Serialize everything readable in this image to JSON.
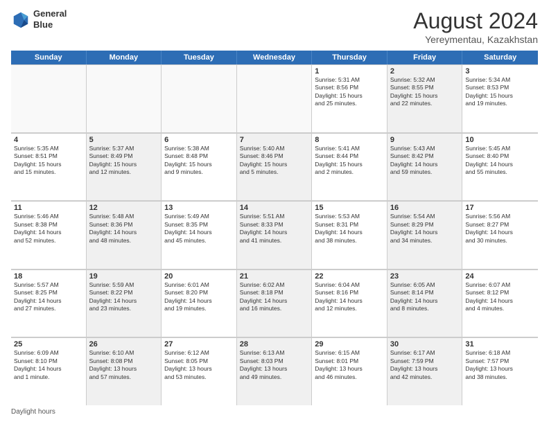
{
  "header": {
    "logo_line1": "General",
    "logo_line2": "Blue",
    "month": "August 2024",
    "location": "Yereymentau, Kazakhstan"
  },
  "weekdays": [
    "Sunday",
    "Monday",
    "Tuesday",
    "Wednesday",
    "Thursday",
    "Friday",
    "Saturday"
  ],
  "footer": "Daylight hours",
  "weeks": [
    [
      {
        "day": "",
        "text": "",
        "empty": true
      },
      {
        "day": "",
        "text": "",
        "empty": true
      },
      {
        "day": "",
        "text": "",
        "empty": true
      },
      {
        "day": "",
        "text": "",
        "empty": true
      },
      {
        "day": "1",
        "text": "Sunrise: 5:31 AM\nSunset: 8:56 PM\nDaylight: 15 hours\nand 25 minutes."
      },
      {
        "day": "2",
        "text": "Sunrise: 5:32 AM\nSunset: 8:55 PM\nDaylight: 15 hours\nand 22 minutes.",
        "shaded": true
      },
      {
        "day": "3",
        "text": "Sunrise: 5:34 AM\nSunset: 8:53 PM\nDaylight: 15 hours\nand 19 minutes."
      }
    ],
    [
      {
        "day": "4",
        "text": "Sunrise: 5:35 AM\nSunset: 8:51 PM\nDaylight: 15 hours\nand 15 minutes."
      },
      {
        "day": "5",
        "text": "Sunrise: 5:37 AM\nSunset: 8:49 PM\nDaylight: 15 hours\nand 12 minutes.",
        "shaded": true
      },
      {
        "day": "6",
        "text": "Sunrise: 5:38 AM\nSunset: 8:48 PM\nDaylight: 15 hours\nand 9 minutes."
      },
      {
        "day": "7",
        "text": "Sunrise: 5:40 AM\nSunset: 8:46 PM\nDaylight: 15 hours\nand 5 minutes.",
        "shaded": true
      },
      {
        "day": "8",
        "text": "Sunrise: 5:41 AM\nSunset: 8:44 PM\nDaylight: 15 hours\nand 2 minutes."
      },
      {
        "day": "9",
        "text": "Sunrise: 5:43 AM\nSunset: 8:42 PM\nDaylight: 14 hours\nand 59 minutes.",
        "shaded": true
      },
      {
        "day": "10",
        "text": "Sunrise: 5:45 AM\nSunset: 8:40 PM\nDaylight: 14 hours\nand 55 minutes."
      }
    ],
    [
      {
        "day": "11",
        "text": "Sunrise: 5:46 AM\nSunset: 8:38 PM\nDaylight: 14 hours\nand 52 minutes."
      },
      {
        "day": "12",
        "text": "Sunrise: 5:48 AM\nSunset: 8:36 PM\nDaylight: 14 hours\nand 48 minutes.",
        "shaded": true
      },
      {
        "day": "13",
        "text": "Sunrise: 5:49 AM\nSunset: 8:35 PM\nDaylight: 14 hours\nand 45 minutes."
      },
      {
        "day": "14",
        "text": "Sunrise: 5:51 AM\nSunset: 8:33 PM\nDaylight: 14 hours\nand 41 minutes.",
        "shaded": true
      },
      {
        "day": "15",
        "text": "Sunrise: 5:53 AM\nSunset: 8:31 PM\nDaylight: 14 hours\nand 38 minutes."
      },
      {
        "day": "16",
        "text": "Sunrise: 5:54 AM\nSunset: 8:29 PM\nDaylight: 14 hours\nand 34 minutes.",
        "shaded": true
      },
      {
        "day": "17",
        "text": "Sunrise: 5:56 AM\nSunset: 8:27 PM\nDaylight: 14 hours\nand 30 minutes."
      }
    ],
    [
      {
        "day": "18",
        "text": "Sunrise: 5:57 AM\nSunset: 8:25 PM\nDaylight: 14 hours\nand 27 minutes."
      },
      {
        "day": "19",
        "text": "Sunrise: 5:59 AM\nSunset: 8:22 PM\nDaylight: 14 hours\nand 23 minutes.",
        "shaded": true
      },
      {
        "day": "20",
        "text": "Sunrise: 6:01 AM\nSunset: 8:20 PM\nDaylight: 14 hours\nand 19 minutes."
      },
      {
        "day": "21",
        "text": "Sunrise: 6:02 AM\nSunset: 8:18 PM\nDaylight: 14 hours\nand 16 minutes.",
        "shaded": true
      },
      {
        "day": "22",
        "text": "Sunrise: 6:04 AM\nSunset: 8:16 PM\nDaylight: 14 hours\nand 12 minutes."
      },
      {
        "day": "23",
        "text": "Sunrise: 6:05 AM\nSunset: 8:14 PM\nDaylight: 14 hours\nand 8 minutes.",
        "shaded": true
      },
      {
        "day": "24",
        "text": "Sunrise: 6:07 AM\nSunset: 8:12 PM\nDaylight: 14 hours\nand 4 minutes."
      }
    ],
    [
      {
        "day": "25",
        "text": "Sunrise: 6:09 AM\nSunset: 8:10 PM\nDaylight: 14 hours\nand 1 minute."
      },
      {
        "day": "26",
        "text": "Sunrise: 6:10 AM\nSunset: 8:08 PM\nDaylight: 13 hours\nand 57 minutes.",
        "shaded": true
      },
      {
        "day": "27",
        "text": "Sunrise: 6:12 AM\nSunset: 8:05 PM\nDaylight: 13 hours\nand 53 minutes."
      },
      {
        "day": "28",
        "text": "Sunrise: 6:13 AM\nSunset: 8:03 PM\nDaylight: 13 hours\nand 49 minutes.",
        "shaded": true
      },
      {
        "day": "29",
        "text": "Sunrise: 6:15 AM\nSunset: 8:01 PM\nDaylight: 13 hours\nand 46 minutes."
      },
      {
        "day": "30",
        "text": "Sunrise: 6:17 AM\nSunset: 7:59 PM\nDaylight: 13 hours\nand 42 minutes.",
        "shaded": true
      },
      {
        "day": "31",
        "text": "Sunrise: 6:18 AM\nSunset: 7:57 PM\nDaylight: 13 hours\nand 38 minutes."
      }
    ]
  ]
}
